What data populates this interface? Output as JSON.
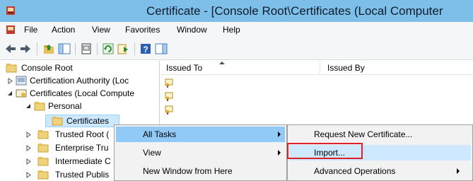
{
  "window": {
    "title": "Certificate - [Console Root\\Certificates (Local Computer"
  },
  "menu": [
    "File",
    "Action",
    "View",
    "Favorites",
    "Window",
    "Help"
  ],
  "toolbar": {
    "icons": [
      "back-arrow-icon",
      "forward-arrow-icon",
      "up-folder-icon",
      "show-hide-tree-icon",
      "properties-icon",
      "refresh-icon",
      "export-list-icon",
      "help-icon",
      "show-action-pane-icon"
    ]
  },
  "tree": {
    "items": [
      {
        "label": "Console Root",
        "icon": "folder-icon",
        "twisty": "none"
      },
      {
        "label": "Certification Authority (Loc",
        "icon": "snapin-icon",
        "twisty": "collapsed"
      },
      {
        "label": "Certificates (Local Compute",
        "icon": "cert-store-icon",
        "twisty": "expanded"
      },
      {
        "label": "Personal",
        "icon": "folder-icon",
        "twisty": "expanded"
      },
      {
        "label": "Certificates",
        "icon": "folder-icon",
        "twisty": "none",
        "selected": true
      },
      {
        "label": "Trusted Root (",
        "icon": "folder-icon",
        "twisty": "collapsed"
      },
      {
        "label": "Enterprise Tru",
        "icon": "folder-icon",
        "twisty": "collapsed"
      },
      {
        "label": "Intermediate C",
        "icon": "folder-icon",
        "twisty": "collapsed"
      },
      {
        "label": "Trusted Publis",
        "icon": "folder-icon",
        "twisty": "collapsed"
      }
    ]
  },
  "list": {
    "columns": [
      "Issued To",
      "Issued By"
    ],
    "sort_column": "Issued To",
    "rows": 3
  },
  "context_menu": {
    "items": [
      {
        "label": "All Tasks",
        "has_submenu": true,
        "highlighted": true
      },
      {
        "label": "View",
        "has_submenu": true
      },
      {
        "label": "New Window from Here",
        "has_submenu": false
      }
    ]
  },
  "submenu": {
    "items": [
      {
        "label": "Request New Certificate...",
        "has_submenu": false
      },
      {
        "label": "Import...",
        "has_submenu": false,
        "highlighted": true,
        "outlined": true
      },
      {
        "label": "Advanced Operations",
        "has_submenu": true
      }
    ]
  },
  "colors": {
    "titlebar": "#7dbfe8",
    "menubar": "#f5f6f7",
    "selection": "#cce8ff",
    "menu_highlight": "#91c9f7",
    "annotation_box": "#e0202a"
  }
}
